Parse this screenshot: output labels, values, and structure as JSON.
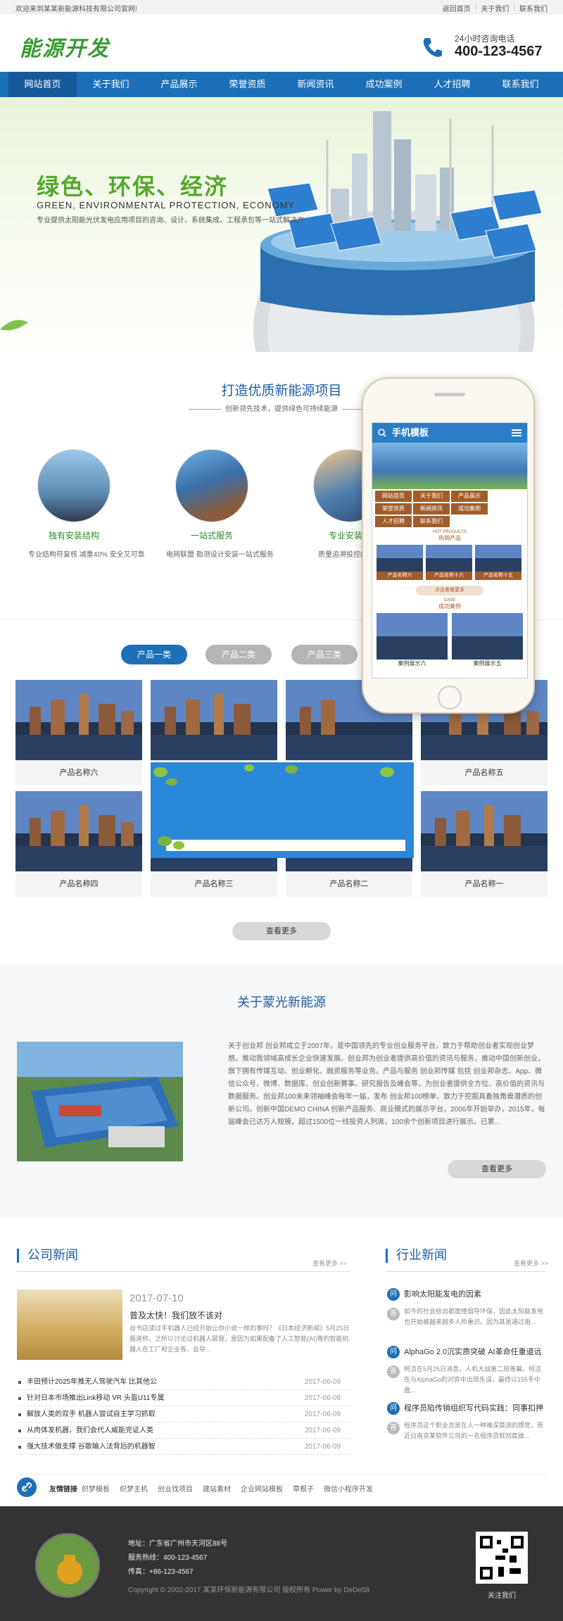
{
  "topbar": {
    "welcome": "欢迎来到某某新能源科技有限公司官网!",
    "links": [
      "返回首页",
      "关于我们",
      "联系我们"
    ]
  },
  "header": {
    "logo_text": "能源开发",
    "hotline_label": "24小时咨询电话",
    "hotline_number": "400-123-4567"
  },
  "nav": {
    "items": [
      "网站首页",
      "关于我们",
      "产品展示",
      "荣誉资质",
      "新闻资讯",
      "成功案例",
      "人才招聘",
      "联系我们"
    ],
    "active_index": 0
  },
  "banner": {
    "title": "绿色、环保、经济",
    "subtitle": "GREEN, ENVIRONMENTAL PROTECTION, ECONOMY",
    "desc": "专业提供太阳能光伏发电应用项目的咨询、设计、系统集成、工程承包等一站式解决方"
  },
  "project": {
    "title": "打造优质新能源项目",
    "subtitle": "创新领先技术，提供绿色可持续能源",
    "services": [
      {
        "title": "独有安装结构",
        "desc": "专业结构符复核 减重40% 安全又可靠"
      },
      {
        "title": "一站式服务",
        "desc": "电网联盟 勘测设计安装一站式服务"
      },
      {
        "title": "专业安装团",
        "desc": "质量追溯投控的安装"
      }
    ]
  },
  "phone_mock": {
    "header": "手机模板",
    "menu": [
      "网站首页",
      "关于我们",
      "产品展示",
      "荣誉资质",
      "新闻资讯",
      "成功案例",
      "人才招聘",
      "联系我们"
    ],
    "hot_products_en": "HOT PRODUCTS",
    "hot_products": "热销产品",
    "products": [
      "产品名称六",
      "产品名称十六",
      "产品名称十五"
    ],
    "more": "点击查看更多",
    "case_en": "CASE",
    "case": "成功案例",
    "cases": [
      "案例展示六",
      "案例展示五"
    ]
  },
  "products": {
    "tabs": [
      "产品一类",
      "产品二类",
      "产品三类"
    ],
    "active_tab": 0,
    "row1": [
      "产品名称六",
      "",
      "",
      "产品名称五"
    ],
    "row2": [
      "产品名称四",
      "产品名称三",
      "产品名称二",
      "产品名称一"
    ],
    "more_label": "查看更多"
  },
  "about": {
    "title": "关于蒙光新能源",
    "text": "关于创业邦 创业邦成立于2007年，是中国领先的专业创业服务平台，致力于帮助创业者实现创业梦想。推动我领域高成长企业快速发展。创业邦为创业者提供高价值的资讯与服务，推动中国创新创业，旗下拥有传媒互动、创业孵化、融资服务等业务。产品与服务 创业邦传媒 包括 创业邦杂志、App、微信公众号、微博、数据库、创业创新赛事、研究报告及峰会等，为创业者提供全方位、高价值的资讯与数据服务。创业邦100未来领袖峰会每年一届，发布 创业邦100榜单，致力于挖掘具备独角兽潜质的创新公司。创新中国DEMO CHINA 创新产品服务、商业模式的展示平台，2006年开始举办，2015年，每届峰会已达万人规模，超过1500位一线投资人列席，100余个创新项目进行展示。已累...",
    "more_label": "查看更多"
  },
  "company_news": {
    "title": "公司新闻",
    "more": "查看更多 >>",
    "featured": {
      "date": "2017-07-10",
      "title": "普及太快！我们放不该对",
      "excerpt": "@书店读过手机器人已经开始让你小说一样的事吗？《日本经济新闻》5月25日报道称，之所以讨论过机器人层我，是因为如果配备了人工智能(AI)等的智能机器人在工厂和企业各、会导..."
    },
    "list": [
      {
        "title": "丰田预计2025年推无人驾驶汽车 比其他公",
        "date": "2017-06-09"
      },
      {
        "title": "针对日本市场推出Link移动 VR 头盔U11专属",
        "date": "2017-06-09"
      },
      {
        "title": "解放人类的双手 机器人尝试自主学习抓取",
        "date": "2017-06-09"
      },
      {
        "title": "从肉体发机器，我们会代人威能完证人类",
        "date": "2017-06-09"
      },
      {
        "title": "强大技术做支撑 谷歌输入法背后的机器智",
        "date": "2017-06-09"
      }
    ]
  },
  "industry_news": {
    "title": "行业新闻",
    "more": "查看更多 >>",
    "items": [
      {
        "title": "影响太阳能发电的因素",
        "desc": "如今的社会给出都面撞倡导环保，因此太阳能发电也开始被越来越多人所重识。因为其是通过祖..."
      },
      {
        "title": "AlphaGo 2.0沉实质突破 AI革命任重道远",
        "desc": "柯洁在5月25日消息，人机大战第二局等幕。柯洁在与AlphaGo的对弈中出现失误，最终以155手中盘..."
      },
      {
        "title": "程序员陷传销组织写代码实践：同事扣押",
        "desc": "程序员这个职业总是在人一种难深莫测的感觉，而近日南京某软件公司的一名程序员就彻底做..."
      }
    ]
  },
  "friend_links": {
    "label": "友情链接",
    "items": [
      "织梦模板",
      "织梦主机",
      "创业找项目",
      "建站素材",
      "企业网站模板",
      "草根子",
      "微信小程序开发"
    ]
  },
  "footer": {
    "address": "地址：广东省广州市天河区88号",
    "service_line": "服务热线：400-123-4567",
    "fax": "传真：+86-123-4567",
    "copyright": "Copyright © 2002-2017 某某环保新能源有限公司 版权所有 Power by DeDe58",
    "qr_caption": "关注我们"
  }
}
